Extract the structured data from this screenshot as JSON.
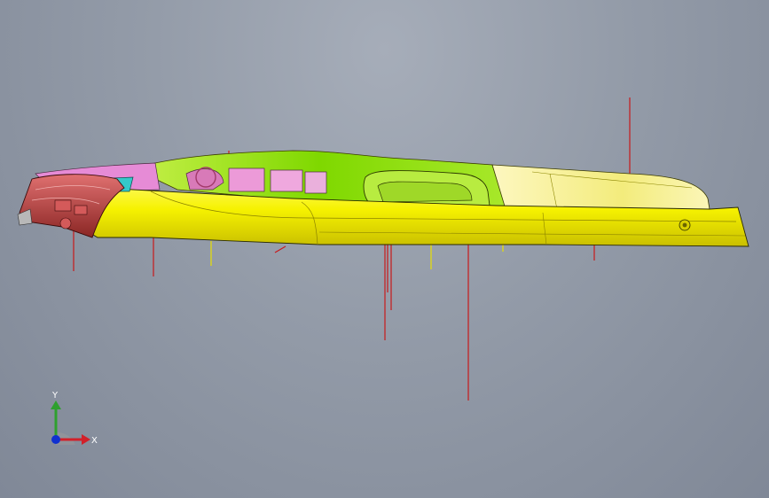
{
  "viewport": {
    "background_color": "#9aa2ae",
    "model_colors": {
      "main_body": "#f3f000",
      "upper_green": "#8fe000",
      "pink_parts": "#e68bd6",
      "red_parts": "#c24a48",
      "cyan_part": "#34c9c9",
      "reference_lines": "#c8191a"
    }
  },
  "triad": {
    "y_label": "Y",
    "x_label": "X",
    "y_color": "#2ea02e",
    "x_color": "#d2202a",
    "z_color": "#1030d0"
  }
}
